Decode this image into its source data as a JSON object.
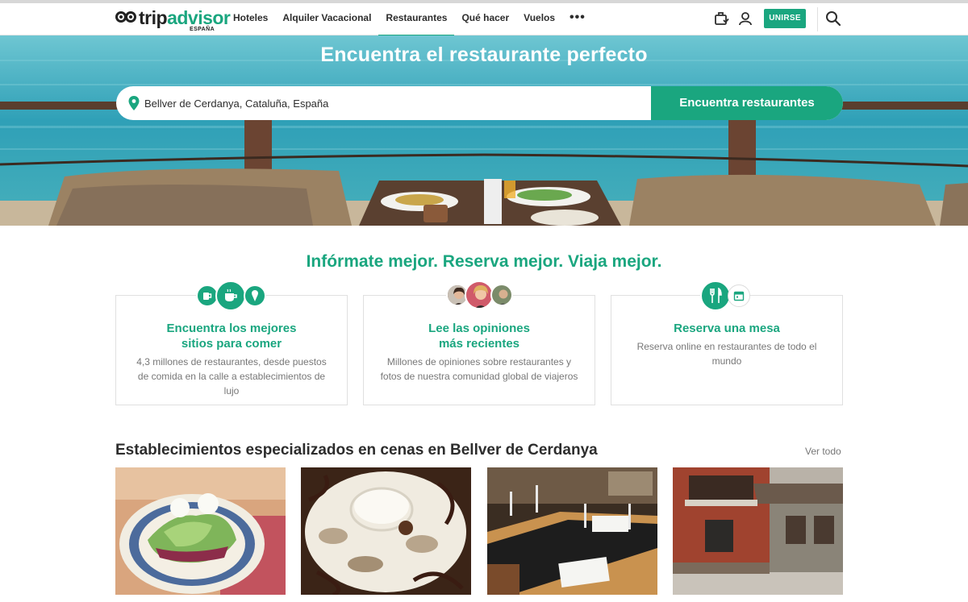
{
  "header": {
    "logo": {
      "brand_main": "trip",
      "brand_accent": "advisor",
      "country": "ESPAÑA"
    },
    "nav": [
      {
        "label": "Hoteles",
        "active": false
      },
      {
        "label": "Alquiler Vacacional",
        "active": false
      },
      {
        "label": "Restaurantes",
        "active": true
      },
      {
        "label": "Qué hacer",
        "active": false
      },
      {
        "label": "Vuelos",
        "active": false
      }
    ],
    "more_label": "•••",
    "join_label": "UNIRSE",
    "icons": [
      "trips-icon",
      "user-icon",
      "search-icon"
    ]
  },
  "hero": {
    "title": "Encuentra el restaurante perfecto",
    "search_value": "Bellver de Cerdanya, Cataluña, España",
    "search_button": "Encuentra restaurantes"
  },
  "features": {
    "tagline": "Infórmate mejor. Reserva mejor. Viaja mejor.",
    "cards": [
      {
        "title_line1": "Encuentra los mejores",
        "title_line2": "sitios para comer",
        "desc": "4,3 millones de restaurantes, desde puestos de comida en la calle a establecimientos de lujo",
        "icons": [
          "drink-icon",
          "coffee-icon",
          "ice-cream-icon"
        ]
      },
      {
        "title_line1": "Lee las opiniones",
        "title_line2": "más recientes",
        "desc": "Millones de opiniones sobre restaurantes y fotos de nuestra comunidad global de viajeros",
        "icons": [
          "avatar",
          "avatar",
          "avatar"
        ]
      },
      {
        "title_line1": "Reserva una mesa",
        "title_line2": "",
        "desc": "Reserva online en restaurantes de todo el mundo",
        "icons": [
          "fork-knife-icon",
          "calendar-icon"
        ]
      }
    ]
  },
  "specialized": {
    "title": "Establecimientos especializados en cenas en Bellver de Cerdanya",
    "see_all": "Ver todo",
    "photos": [
      "salad-photo",
      "goat-cheese-photo",
      "dining-room-photo",
      "restaurant-facade-photo"
    ]
  },
  "colors": {
    "brand_green": "#1aa67f",
    "text_dark": "#2d2d2d",
    "text_muted": "#777777"
  }
}
